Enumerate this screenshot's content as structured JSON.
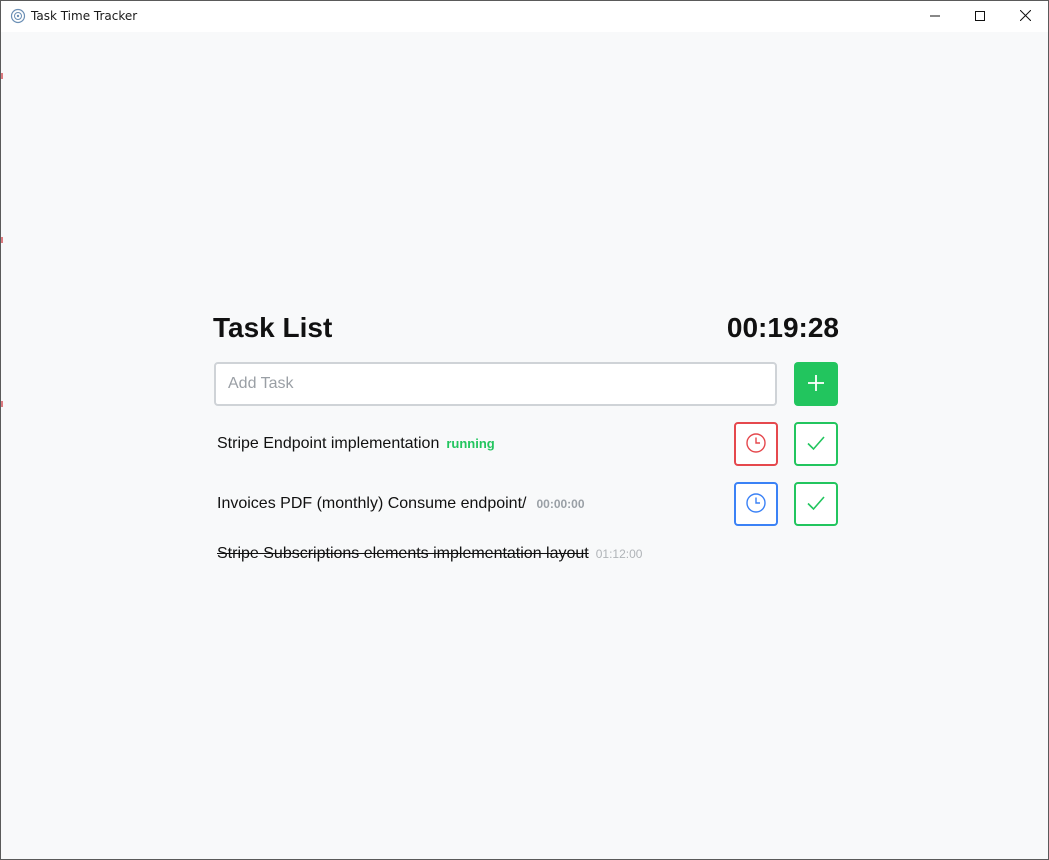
{
  "window": {
    "title": "Task Time Tracker"
  },
  "header": {
    "title": "Task List",
    "timer": "00:19:28"
  },
  "add_task": {
    "placeholder": "Add Task",
    "value": ""
  },
  "tasks": [
    {
      "name": "Stripe Endpoint implementation",
      "status": "running",
      "completed": false,
      "clock_color": "#e5484d"
    },
    {
      "name": "Invoices PDF (monthly) Consume endpoint/",
      "status": "00:00:00",
      "completed": false,
      "clock_color": "#3b82f6"
    },
    {
      "name": "Stripe Subscriptions elements implementation layout",
      "status": "01:12:00",
      "completed": true
    }
  ],
  "colors": {
    "accent_green": "#22c55e",
    "running_red": "#e5484d",
    "idle_blue": "#3b82f6",
    "background": "#f8f9fa"
  },
  "icons": {
    "app": "app-logo-icon",
    "minimize": "minimize-icon",
    "maximize": "maximize-icon",
    "close": "close-icon",
    "add": "plus-icon",
    "clock": "clock-icon",
    "check": "check-icon"
  }
}
